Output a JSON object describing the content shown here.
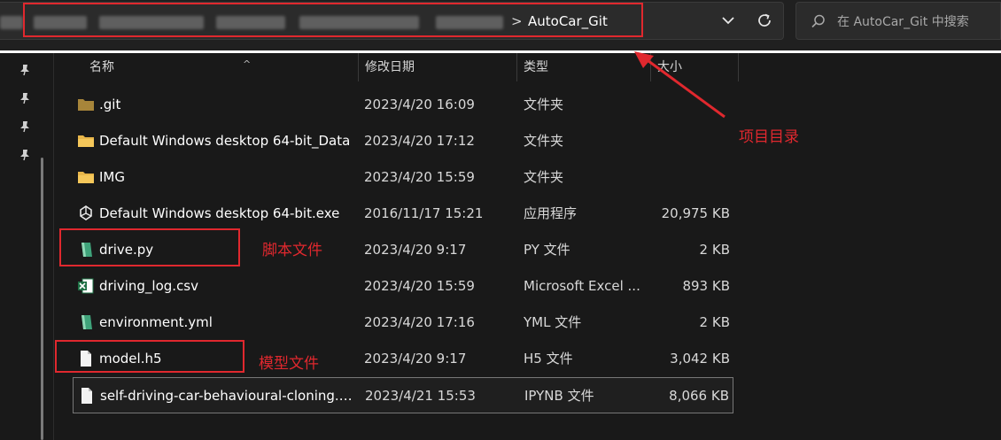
{
  "address_bar": {
    "current_folder": "AutoCar_Git",
    "separator": ">"
  },
  "search": {
    "placeholder": "在 AutoCar_Git 中搜索"
  },
  "columns": {
    "name": "名称",
    "date": "修改日期",
    "type": "类型",
    "size": "大小"
  },
  "files": [
    {
      "name": ".git",
      "date": "2023/4/20 16:09",
      "type": "文件夹",
      "size": "",
      "icon": "folder-icon"
    },
    {
      "name": "Default Windows desktop 64-bit_Data",
      "date": "2023/4/20 17:12",
      "type": "文件夹",
      "size": "",
      "icon": "folder-icon"
    },
    {
      "name": "IMG",
      "date": "2023/4/20 15:59",
      "type": "文件夹",
      "size": "",
      "icon": "folder-icon"
    },
    {
      "name": "Default Windows desktop 64-bit.exe",
      "date": "2016/11/17 15:21",
      "type": "应用程序",
      "size": "20,975 KB",
      "icon": "unity-icon"
    },
    {
      "name": "drive.py",
      "date": "2023/4/20 9:17",
      "type": "PY 文件",
      "size": "2 KB",
      "icon": "script-icon"
    },
    {
      "name": "driving_log.csv",
      "date": "2023/4/20 15:59",
      "type": "Microsoft Excel ...",
      "size": "893 KB",
      "icon": "excel-icon"
    },
    {
      "name": "environment.yml",
      "date": "2023/4/20 17:16",
      "type": "YML 文件",
      "size": "2 KB",
      "icon": "script-icon"
    },
    {
      "name": "model.h5",
      "date": "2023/4/20 9:17",
      "type": "H5 文件",
      "size": "3,042 KB",
      "icon": "file-icon"
    },
    {
      "name": "self-driving-car-behavioural-cloning.i...",
      "date": "2023/4/21 15:53",
      "type": "IPYNB 文件",
      "size": "8,066 KB",
      "icon": "file-icon"
    }
  ],
  "annotations": {
    "project_dir": "项目目录",
    "script_file": "脚本文件",
    "model_file": "模型文件",
    "color": "#e0282e"
  },
  "colors": {
    "background": "#191919",
    "folder": "#e8b64a",
    "git_folder": "#a7853a",
    "highlight": "#e0282e"
  }
}
